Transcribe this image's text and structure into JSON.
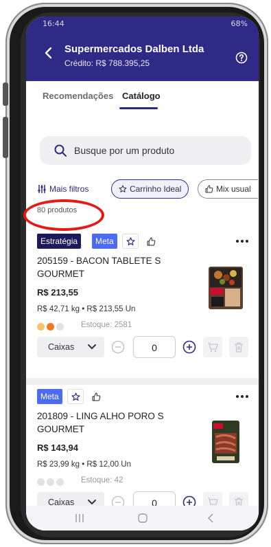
{
  "status_bar": {
    "time": "16:44",
    "battery": "68%"
  },
  "header": {
    "title": "Supermercados Dalben Ltda",
    "credit": "Crédito: R$ 788.395,25"
  },
  "tabs": [
    {
      "label": "Recomendações",
      "active": false
    },
    {
      "label": "Catálogo",
      "active": true
    }
  ],
  "search": {
    "placeholder": "Busque por um produto"
  },
  "filters": {
    "more_label": "Mais filtros",
    "chips": [
      {
        "label": "Carrinho Ideal",
        "icon": "star-icon",
        "selected": true
      },
      {
        "label": "Mix usual",
        "icon": "thumbs-up-icon",
        "selected": false
      }
    ]
  },
  "product_count": "80 produtos",
  "products": [
    {
      "badges": [
        "Estratégia",
        "Meta"
      ],
      "name": "205159 - BACON TABLETE S GOURMET",
      "price": "R$ 213,55",
      "unit_price": "R$ 42,71 kg • R$ 213,55 Un",
      "stock": "Estoque: 2581",
      "stock_dots": [
        "#f5c56a",
        "#f07b1e",
        "#e2e2e2"
      ],
      "package": "Caixas",
      "quantity": "0"
    },
    {
      "badges": [
        "Meta"
      ],
      "name": "201809 - LING ALHO PORO S GOURMET",
      "price": "R$ 143,94",
      "unit_price": "R$ 23,99 kg • R$ 12,00 Un",
      "stock": "Estoque: 42",
      "stock_dots": [
        "#e2e2e2",
        "#e2e2e2",
        "#e2e2e2"
      ],
      "package": "Caixas",
      "quantity": "0"
    }
  ],
  "colors": {
    "primary": "#2f2a86",
    "badge_strategy": "#1d1a5c",
    "badge_meta": "#4b6bf0",
    "annotation": "#e61919"
  }
}
